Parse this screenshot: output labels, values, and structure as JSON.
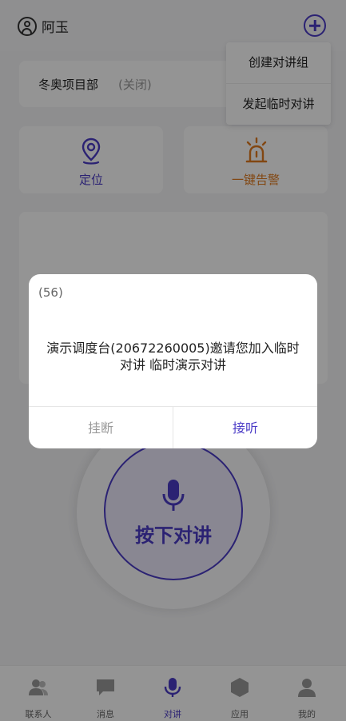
{
  "header": {
    "user_name": "阿玉"
  },
  "menu": {
    "items": [
      "创建对讲组",
      "发起临时对讲"
    ]
  },
  "group": {
    "name": "冬奥项目部",
    "status": "(关闭)"
  },
  "actions": {
    "locate": "定位",
    "alarm": "一键告警"
  },
  "ptt": {
    "label": "按下对讲"
  },
  "nav": {
    "contacts": "联系人",
    "messages": "消息",
    "ptt": "对讲",
    "apps": "应用",
    "me": "我的"
  },
  "dialog": {
    "count": "(56)",
    "message": "演示调度台(20672260005)邀请您加入临时对讲 临时演示对讲",
    "hangup": "挂断",
    "answer": "接听"
  },
  "colors": {
    "accent": "#4a3bc6",
    "alarm": "#e07a1f"
  }
}
